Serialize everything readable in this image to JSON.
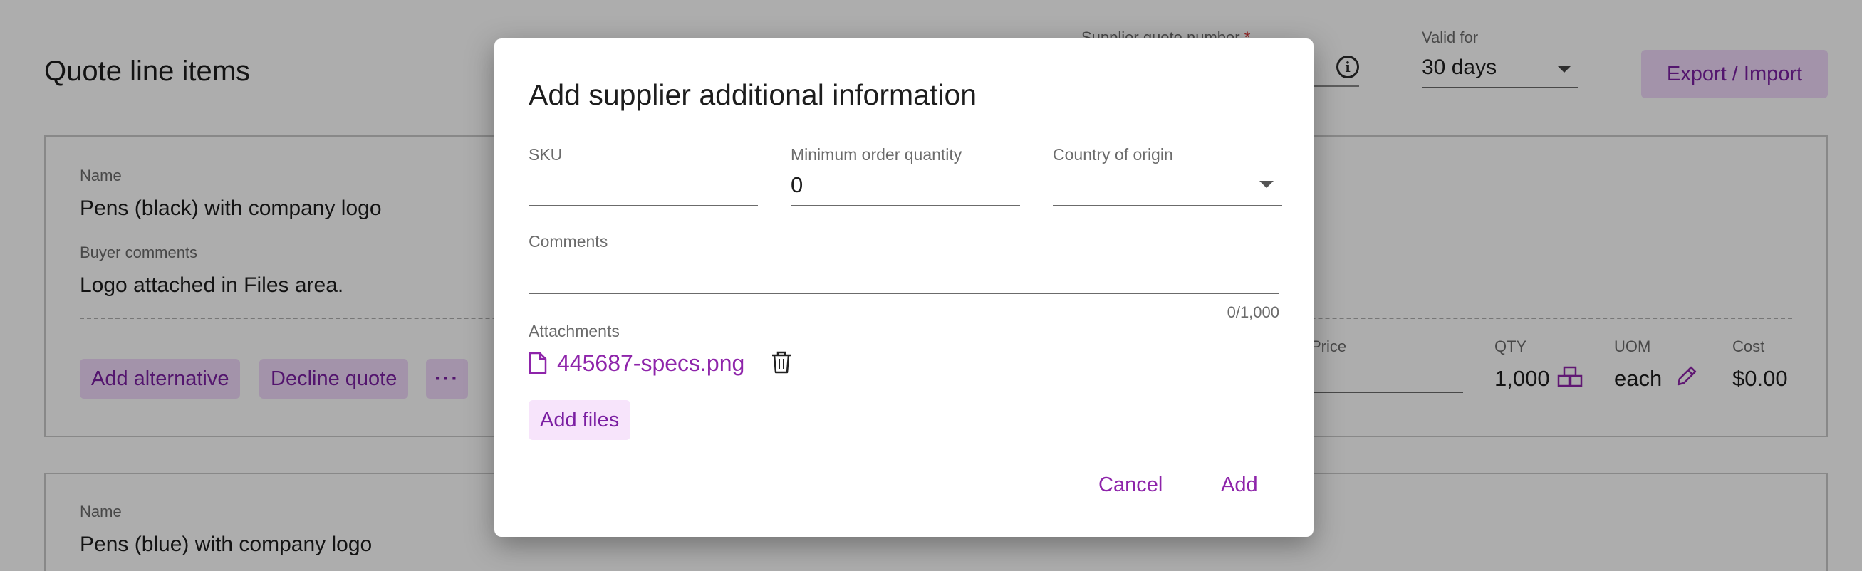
{
  "page": {
    "title": "Quote line items",
    "supplier_quote_number": {
      "label": "Supplier quote number",
      "required_mark": "*"
    },
    "valid_for": {
      "label": "Valid for",
      "value": "30 days"
    },
    "export_import_label": "Export / Import",
    "cards": [
      {
        "name_label": "Name",
        "name_value": "Pens (black) with company logo",
        "comments_label": "Buyer comments",
        "comments_value": "Logo attached in Files area.",
        "actions": {
          "add_alternative": "Add alternative",
          "decline_quote": "Decline quote",
          "more": "···"
        },
        "columns": {
          "price_label": "Price",
          "qty_label": "QTY",
          "qty_value": "1,000",
          "uom_label": "UOM",
          "uom_value": "each",
          "cost_label": "Cost",
          "cost_value": "$0.00"
        }
      },
      {
        "name_label": "Name",
        "name_value": "Pens (blue) with company logo"
      }
    ]
  },
  "dialog": {
    "title": "Add supplier additional information",
    "sku": {
      "label": "SKU",
      "value": ""
    },
    "min_order_qty": {
      "label": "Minimum order quantity",
      "value": "0"
    },
    "country": {
      "label": "Country of origin",
      "value": ""
    },
    "comments": {
      "label": "Comments",
      "value": "",
      "counter": "0/1,000"
    },
    "attachments": {
      "label": "Attachments",
      "files": [
        "445687-specs.png"
      ]
    },
    "add_files_label": "Add files",
    "cancel_label": "Cancel",
    "add_label": "Add"
  },
  "colors": {
    "accent": "#8e24aa",
    "chip_bg": "#f1d9fb",
    "scrim": "rgba(0,0,0,0.32)"
  },
  "icons": [
    "info-icon",
    "chevron-down-icon",
    "box-icon",
    "pencil-icon",
    "file-icon",
    "trash-icon"
  ]
}
